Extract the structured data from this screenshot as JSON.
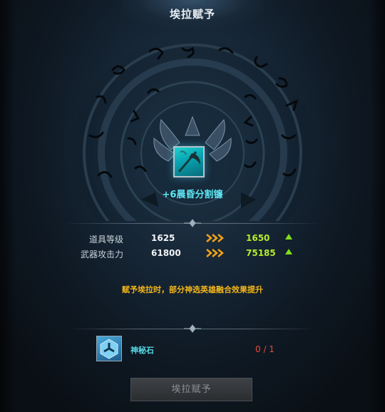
{
  "window": {
    "title": "埃拉赋予"
  },
  "item": {
    "name": "+6晨昏分割镰"
  },
  "stats": [
    {
      "label": "道具等级",
      "old": "1625",
      "new": "1650"
    },
    {
      "label": "武器攻击力",
      "old": "61800",
      "new": "75185"
    }
  ],
  "notice": "赋予埃拉时，部分神选英雄融合效果提升",
  "material": {
    "name": "神秘石",
    "count": "0 / 1"
  },
  "confirm_button": {
    "label": "埃拉赋予",
    "enabled": false
  },
  "colors": {
    "increase": "#b6ec2a",
    "up_arrow": "#7fe01a",
    "notice": "#f2b51a",
    "item_name": "#5ee6f2",
    "insufficient": "#e44d3a"
  },
  "icons": {
    "item": "scythe-weapon-icon",
    "material": "mystic-stone-icon",
    "arrow": "triple-chevron-right-icon",
    "increase": "triangle-up-icon"
  }
}
